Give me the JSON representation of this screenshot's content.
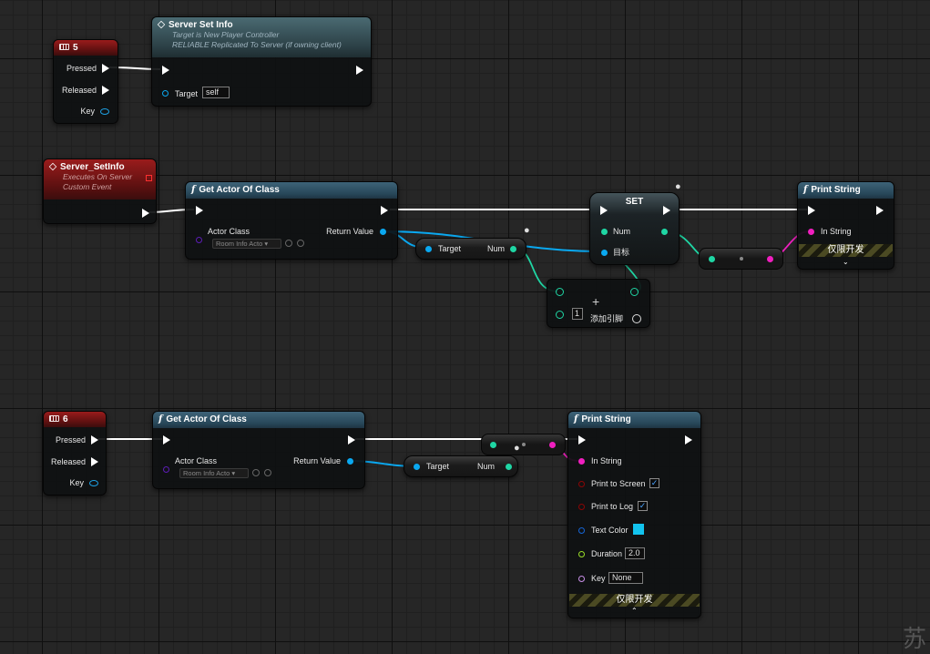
{
  "events": {
    "key5": {
      "title": "5",
      "pressed": "Pressed",
      "released": "Released",
      "key": "Key"
    },
    "key6": {
      "title": "6",
      "pressed": "Pressed",
      "released": "Released",
      "key": "Key"
    },
    "server_setinfo_event": {
      "title": "Server_SetInfo",
      "sub1": "Executes On Server",
      "sub2": "Custom Event"
    }
  },
  "server_set_info": {
    "title": "Server Set Info",
    "sub1": "Target is New Player Controller",
    "sub2": "RELIABLE Replicated To Server (if owning client)",
    "target_label": "Target",
    "target_value": "self"
  },
  "get_actor_1": {
    "title": "Get Actor Of Class",
    "actor_class": "Actor Class",
    "return_value": "Return Value",
    "class_value": "Room Info Acto"
  },
  "get_actor_2": {
    "title": "Get Actor Of Class",
    "actor_class": "Actor Class",
    "return_value": "Return Value",
    "class_value": "Room Info Acto"
  },
  "get_num_1": {
    "target": "Target",
    "num": "Num"
  },
  "get_num_2": {
    "target": "Target",
    "num": "Num"
  },
  "set_node": {
    "title": "SET",
    "num": "Num",
    "target": "目标"
  },
  "append_node": {
    "index": "1",
    "add_pin": "添加引脚"
  },
  "print_string_1": {
    "title": "Print String",
    "in_string": "In String",
    "dev_only": "仅限开发"
  },
  "print_string_2": {
    "title": "Print String",
    "in_string": "In String",
    "print_to_screen": "Print to Screen",
    "print_to_log": "Print to Log",
    "text_color": "Text Color",
    "duration": "Duration",
    "duration_value": "2.0",
    "key": "Key",
    "key_value": "None",
    "dev_only": "仅限开发"
  },
  "colors": {
    "exec": "#ffffff",
    "object_pin": "#0aa8f0",
    "integer_pin": "#1fd6a4",
    "string_pin": "#f01fbf",
    "class_pin": "#5c1db6",
    "bool_pin": "#8c0505",
    "text_color_value": "#12c3ee"
  },
  "icons": [
    "keyboard-icon",
    "event-diamond-icon",
    "function-icon",
    "exec-pin-icon",
    "data-pin-icon",
    "add-pin-icon",
    "search-icon",
    "browse-icon",
    "chevron-down-icon",
    "chevron-up-icon",
    "breakpoint-icon",
    "comment-bubble-icon"
  ],
  "watermark": "苏"
}
